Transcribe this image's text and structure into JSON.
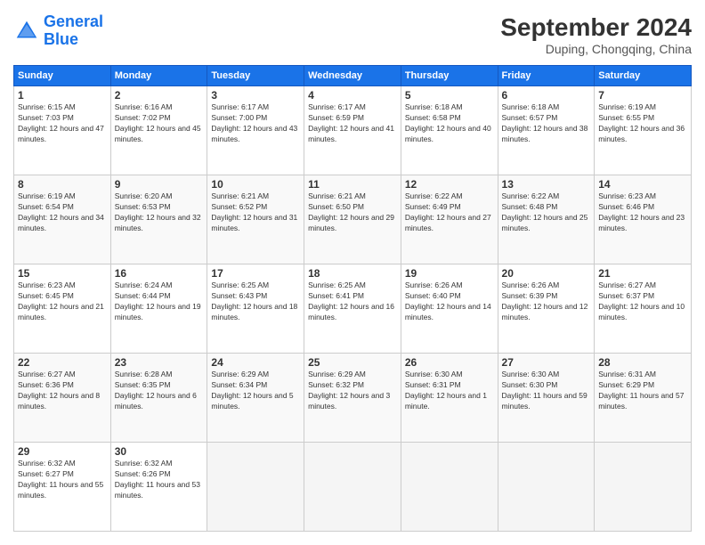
{
  "logo": {
    "line1": "General",
    "line2": "Blue"
  },
  "title": "September 2024",
  "subtitle": "Duping, Chongqing, China",
  "days_header": [
    "Sunday",
    "Monday",
    "Tuesday",
    "Wednesday",
    "Thursday",
    "Friday",
    "Saturday"
  ],
  "weeks": [
    [
      {
        "day": "1",
        "sunrise": "6:15 AM",
        "sunset": "7:03 PM",
        "daylight": "12 hours and 47 minutes."
      },
      {
        "day": "2",
        "sunrise": "6:16 AM",
        "sunset": "7:02 PM",
        "daylight": "12 hours and 45 minutes."
      },
      {
        "day": "3",
        "sunrise": "6:17 AM",
        "sunset": "7:00 PM",
        "daylight": "12 hours and 43 minutes."
      },
      {
        "day": "4",
        "sunrise": "6:17 AM",
        "sunset": "6:59 PM",
        "daylight": "12 hours and 41 minutes."
      },
      {
        "day": "5",
        "sunrise": "6:18 AM",
        "sunset": "6:58 PM",
        "daylight": "12 hours and 40 minutes."
      },
      {
        "day": "6",
        "sunrise": "6:18 AM",
        "sunset": "6:57 PM",
        "daylight": "12 hours and 38 minutes."
      },
      {
        "day": "7",
        "sunrise": "6:19 AM",
        "sunset": "6:55 PM",
        "daylight": "12 hours and 36 minutes."
      }
    ],
    [
      {
        "day": "8",
        "sunrise": "6:19 AM",
        "sunset": "6:54 PM",
        "daylight": "12 hours and 34 minutes."
      },
      {
        "day": "9",
        "sunrise": "6:20 AM",
        "sunset": "6:53 PM",
        "daylight": "12 hours and 32 minutes."
      },
      {
        "day": "10",
        "sunrise": "6:21 AM",
        "sunset": "6:52 PM",
        "daylight": "12 hours and 31 minutes."
      },
      {
        "day": "11",
        "sunrise": "6:21 AM",
        "sunset": "6:50 PM",
        "daylight": "12 hours and 29 minutes."
      },
      {
        "day": "12",
        "sunrise": "6:22 AM",
        "sunset": "6:49 PM",
        "daylight": "12 hours and 27 minutes."
      },
      {
        "day": "13",
        "sunrise": "6:22 AM",
        "sunset": "6:48 PM",
        "daylight": "12 hours and 25 minutes."
      },
      {
        "day": "14",
        "sunrise": "6:23 AM",
        "sunset": "6:46 PM",
        "daylight": "12 hours and 23 minutes."
      }
    ],
    [
      {
        "day": "15",
        "sunrise": "6:23 AM",
        "sunset": "6:45 PM",
        "daylight": "12 hours and 21 minutes."
      },
      {
        "day": "16",
        "sunrise": "6:24 AM",
        "sunset": "6:44 PM",
        "daylight": "12 hours and 19 minutes."
      },
      {
        "day": "17",
        "sunrise": "6:25 AM",
        "sunset": "6:43 PM",
        "daylight": "12 hours and 18 minutes."
      },
      {
        "day": "18",
        "sunrise": "6:25 AM",
        "sunset": "6:41 PM",
        "daylight": "12 hours and 16 minutes."
      },
      {
        "day": "19",
        "sunrise": "6:26 AM",
        "sunset": "6:40 PM",
        "daylight": "12 hours and 14 minutes."
      },
      {
        "day": "20",
        "sunrise": "6:26 AM",
        "sunset": "6:39 PM",
        "daylight": "12 hours and 12 minutes."
      },
      {
        "day": "21",
        "sunrise": "6:27 AM",
        "sunset": "6:37 PM",
        "daylight": "12 hours and 10 minutes."
      }
    ],
    [
      {
        "day": "22",
        "sunrise": "6:27 AM",
        "sunset": "6:36 PM",
        "daylight": "12 hours and 8 minutes."
      },
      {
        "day": "23",
        "sunrise": "6:28 AM",
        "sunset": "6:35 PM",
        "daylight": "12 hours and 6 minutes."
      },
      {
        "day": "24",
        "sunrise": "6:29 AM",
        "sunset": "6:34 PM",
        "daylight": "12 hours and 5 minutes."
      },
      {
        "day": "25",
        "sunrise": "6:29 AM",
        "sunset": "6:32 PM",
        "daylight": "12 hours and 3 minutes."
      },
      {
        "day": "26",
        "sunrise": "6:30 AM",
        "sunset": "6:31 PM",
        "daylight": "12 hours and 1 minute."
      },
      {
        "day": "27",
        "sunrise": "6:30 AM",
        "sunset": "6:30 PM",
        "daylight": "11 hours and 59 minutes."
      },
      {
        "day": "28",
        "sunrise": "6:31 AM",
        "sunset": "6:29 PM",
        "daylight": "11 hours and 57 minutes."
      }
    ],
    [
      {
        "day": "29",
        "sunrise": "6:32 AM",
        "sunset": "6:27 PM",
        "daylight": "11 hours and 55 minutes."
      },
      {
        "day": "30",
        "sunrise": "6:32 AM",
        "sunset": "6:26 PM",
        "daylight": "11 hours and 53 minutes."
      },
      {
        "day": "",
        "sunrise": "",
        "sunset": "",
        "daylight": ""
      },
      {
        "day": "",
        "sunrise": "",
        "sunset": "",
        "daylight": ""
      },
      {
        "day": "",
        "sunrise": "",
        "sunset": "",
        "daylight": ""
      },
      {
        "day": "",
        "sunrise": "",
        "sunset": "",
        "daylight": ""
      },
      {
        "day": "",
        "sunrise": "",
        "sunset": "",
        "daylight": ""
      }
    ]
  ]
}
